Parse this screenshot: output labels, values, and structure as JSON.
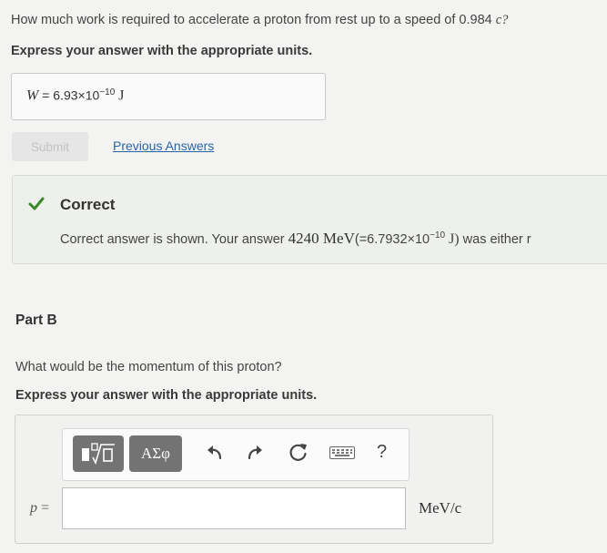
{
  "part_a": {
    "question": "How much work is required to accelerate a proton from rest up to a speed of 0.984 ",
    "question_var": "c?",
    "units_instruction": "Express your answer with the appropriate units.",
    "answer_var": "W",
    "answer_eq": " = ",
    "answer_mantissa": "6.93×10",
    "answer_exp": "−10",
    "answer_unit": " J",
    "submit_label": "Submit",
    "previous_answers_label": "Previous Answers"
  },
  "feedback": {
    "title": "Correct",
    "msg_prefix": "Correct answer is shown. Your answer ",
    "msg_value": "4240 MeV",
    "msg_paren_open": "(=6.7932×10",
    "msg_exp": "−10",
    "msg_unit": " J)",
    "msg_suffix": " was either r",
    "status_color": "#3a8a2a"
  },
  "part_b": {
    "label": "Part B",
    "question": "What would be the momentum of this proton?",
    "units_instruction": "Express your answer with the appropriate units.",
    "symbol_button_label": "ΑΣφ",
    "help_label": "?",
    "answer_var": "p",
    "answer_eq": " =",
    "unit_label": "MeV/c"
  },
  "icons": [
    "templates-icon",
    "greek-symbols-icon",
    "undo-icon",
    "redo-icon",
    "reset-icon",
    "keyboard-icon",
    "help-icon",
    "check-icon"
  ]
}
